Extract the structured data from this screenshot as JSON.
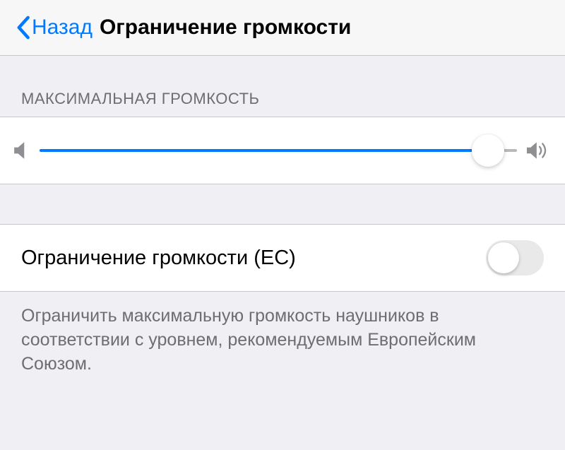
{
  "header": {
    "back_label": "Назад",
    "page_title": "Ограничение громкости"
  },
  "section": {
    "max_volume_header": "МАКСИМАЛЬНАЯ ГРОМКОСТЬ"
  },
  "slider": {
    "value_percent": 94
  },
  "toggle": {
    "label": "Ограничение громкости (ЕС)",
    "on": false
  },
  "footer": {
    "description": "Ограничить максимальную громкость наушников в соответствии с уровнем, рекомендуемым Европейским Союзом."
  }
}
